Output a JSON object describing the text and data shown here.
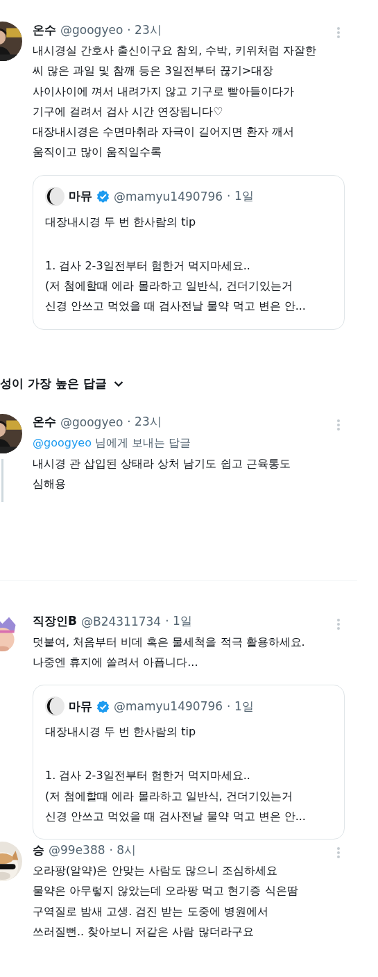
{
  "posts": [
    {
      "kind": "tweet",
      "avatar": {
        "kind": "picture"
      },
      "name": "온수",
      "handle": "@googyeo",
      "time": "· 23시",
      "lines": [
        "내시경실 간호사 출신이구요 참외, 수박, 키위처럼 자잘한",
        "씨 많은 과일 및 참깨 등은 3일전부터 끊기>대장",
        "사이사이에 껴서 내려가지 않고 기구로 빨아들이다가",
        "기구에 걸려서 검사 시간 연장됩니다♡",
        "대장내시경은 수면마취라 자극이 길어지면 환자 깨서",
        "움직이고 많이 움직일수록"
      ],
      "quote": {
        "name": "마뮤",
        "verified": true,
        "handle": "@mamyu1490796",
        "time": "· 1일",
        "title": "대장내시경 두 번 한사람의 tip",
        "lines": [
          "1. 검사 2-3일전부터 험한거 먹지마세요..",
          "(저 첨에할때 에라 몰라하고 일반식, 건더기있는거",
          "신경 안쓰고 먹었을 때 검사전날 물약 먹고 변은 안..."
        ]
      }
    },
    {
      "kind": "sort",
      "label": "성이 가장 높은 답글"
    },
    {
      "kind": "tweet",
      "avatar": {
        "kind": "picture"
      },
      "thread": true,
      "name": "온수",
      "handle": "@googyeo",
      "time": "· 23시",
      "reply_to": {
        "handle": "@googyeo",
        "text": "님에게 보내는 답글"
      },
      "lines": [
        "내시경 관 삽입된 상태라 상처 남기도 쉽고 근육통도",
        "심해용"
      ]
    },
    {
      "kind": "divider"
    },
    {
      "kind": "tweet",
      "avatar": {
        "kind": "picture"
      },
      "name": "직장인B",
      "handle": "@B24311734",
      "time": "· 1일",
      "lines": [
        "덧붙여, 처음부터 비데 혹은 물세척을 적극 활용하세요.",
        "나중엔 휴지에 쓸려서 아픕니다..."
      ],
      "quote": {
        "name": "마뮤",
        "verified": true,
        "handle": "@mamyu1490796",
        "time": "· 1일",
        "title": "대장내시경 두 번 한사람의 tip",
        "lines": [
          "1. 검사 2-3일전부터 험한거 먹지마세요..",
          "(저 첨에할때 에라 몰라하고 일반식, 건더기있는거",
          "신경 안쓰고 먹었을 때 검사전날 물약 먹고 변은 안..."
        ]
      }
    },
    {
      "kind": "tweet",
      "avatar": {
        "kind": "picture"
      },
      "name": "승",
      "handle": "@99e388",
      "time": "· 8시",
      "lines": [
        "오라팡(알약)은 안맞는 사람도 많으니 조심하세요",
        "물약은 아무렇지 않았는데 오라팡 먹고 현기증 식은땀",
        "구역질로 밤새 고생. 검진 받는 도중에 병원에서",
        "쓰러질뻔.. 찾아보니 저같은 사람 많더라구요"
      ]
    }
  ]
}
